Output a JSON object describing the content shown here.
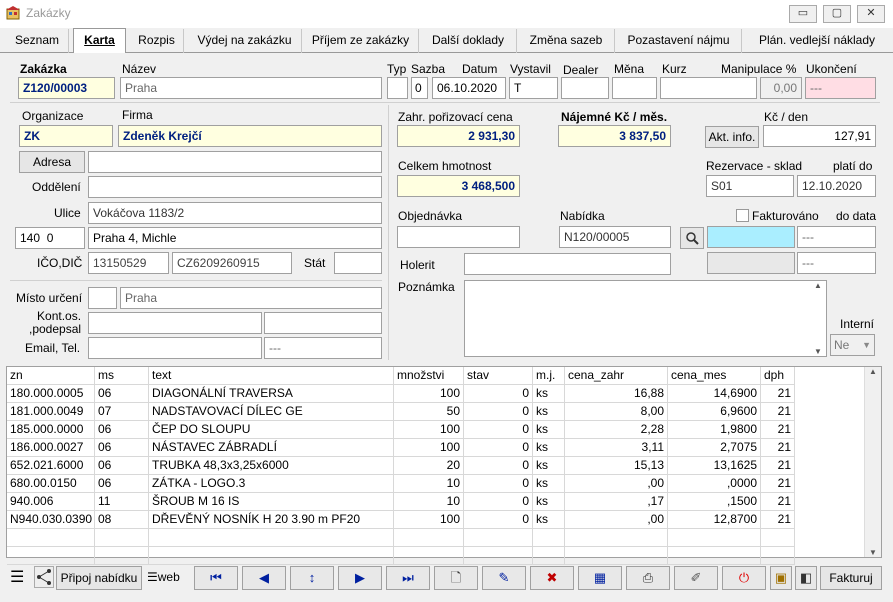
{
  "window": {
    "title": "Zakázky",
    "minimize": "▭",
    "maximize": "▢",
    "close": "✕"
  },
  "tabs": [
    "Seznam",
    "Karta",
    "Rozpis",
    "Výdej na zakázku",
    "Příjem ze zakázky",
    "Další doklady",
    "Změna sazeb",
    "Pozastavení nájmu",
    "Plán. vedlejší náklady"
  ],
  "header": {
    "zakazka_label": "Zakázka",
    "zakazka": "Z120/00003",
    "nazev_label": "Název",
    "nazev": "Praha",
    "typ_label": "Typ",
    "typ": "",
    "sazba_label": "Sazba",
    "sazba": "0",
    "datum_label": "Datum",
    "datum": "06.10.2020",
    "vystavil_label": "Vystavil",
    "vystavil": "T",
    "dealer_label": "Dealer",
    "dealer": "",
    "mena_label": "Měna",
    "mena": "",
    "kurz_label": "Kurz",
    "kurz": "",
    "manipulace_label": "Manipulace %",
    "manipulace": "0,00",
    "ukonceni_label": "Ukončení",
    "ukonceni": "---"
  },
  "left": {
    "organizace_label": "Organizace",
    "organizace": "ZK",
    "firma_label": "Firma",
    "firma": "Zdeněk Krejčí",
    "adresa_button": "Adresa",
    "adresa": "",
    "oddeleni_label": "Oddělení",
    "oddeleni": "",
    "ulice_label": "Ulice",
    "ulice": "Vokáčova 1183/2",
    "psc": "140  0",
    "mesto": "Praha 4, Michle",
    "icodic_label": "IČO,DIČ",
    "ico": "13150529",
    "dic": "CZ6209260915",
    "stat_label": "Stát",
    "stat": "",
    "misto_label": "Místo určení",
    "misto_code": "",
    "misto": "Praha",
    "kontos_label": "Kont.os.\n,podepsal",
    "kontos1": "",
    "kontos2": "",
    "email_label": "Email, Tel.",
    "email": "",
    "tel": "---"
  },
  "right": {
    "zahr_label": "Zahr. pořizovací cena",
    "zahr": "2 931,30",
    "najemne_label": "Nájemné Kč / měs.",
    "najemne": "3 837,50",
    "akt_button": "Akt. info.",
    "kcden_label": "Kč / den",
    "kcden": "127,91",
    "hmotnost_label": "Celkem hmotnost",
    "hmotnost": "3 468,500",
    "rezervace_label": "Rezervace - sklad",
    "sklad": "S01",
    "platido_label": "platí do",
    "platido": "12.10.2020",
    "objednavka_label": "Objednávka",
    "objednavka": "",
    "nabidka_label": "Nabídka",
    "nabidka": "N120/00005",
    "fakturovano_label": "Fakturováno",
    "dodata_label": "do data",
    "fak1": "",
    "fak1_date": "---",
    "fak2": "",
    "fak2_date": "---",
    "holerit_label": "Holerit",
    "holerit": "",
    "poznamka_label": "Poznámka",
    "poznamka": "",
    "interni_label": "Interní",
    "interni": "Ne"
  },
  "table": {
    "columns": [
      "zn",
      "ms",
      "text",
      "množstvi",
      "stav",
      "m.j.",
      "cena_zahr",
      "cena_mes",
      "dph"
    ],
    "rows": [
      [
        "180.000.0005",
        "06",
        "DIAGONÁLNÍ TRAVERSA",
        "100",
        "0",
        "ks",
        "16,88",
        "14,6900",
        "21"
      ],
      [
        "181.000.0049",
        "07",
        "NADSTAVOVACÍ DÍLEC GE",
        "50",
        "0",
        "ks",
        "8,00",
        "6,9600",
        "21"
      ],
      [
        "185.000.0000",
        "06",
        "ČEP DO SLOUPU",
        "100",
        "0",
        "ks",
        "2,28",
        "1,9800",
        "21"
      ],
      [
        "186.000.0027",
        "06",
        "NÁSTAVEC ZÁBRADLÍ",
        "100",
        "0",
        "ks",
        "3,11",
        "2,7075",
        "21"
      ],
      [
        "652.021.6000",
        "06",
        "TRUBKA 48,3x3,25x6000",
        "20",
        "0",
        "ks",
        "15,13",
        "13,1625",
        "21"
      ],
      [
        "680.00.0150",
        "06",
        "ZÁTKA - LOGO.3",
        "10",
        "0",
        "ks",
        ",00",
        ",0000",
        "21"
      ],
      [
        "940.006",
        "11",
        "ŠROUB M 16 IS",
        "10",
        "0",
        "ks",
        ",17",
        ",1500",
        "21"
      ],
      [
        "N940.030.0390",
        "08",
        "DŘEVĚNÝ NOSNÍK H 20 3.90 m PF20",
        "100",
        "0",
        "ks",
        ",00",
        "12,8700",
        "21"
      ],
      [
        "",
        "",
        "",
        "",
        "",
        "",
        "",
        "",
        ""
      ],
      [
        "",
        "",
        "",
        "",
        "",
        "",
        "",
        "",
        ""
      ]
    ]
  },
  "toolbar": {
    "menu": "☰",
    "tree": "⋰",
    "pripoj": "Připoj nabídku",
    "web": "☰web",
    "first": "⏮",
    "prev": "◀",
    "sort": "↕",
    "next": "▶",
    "last": "⏭",
    "new": "🗋",
    "edit": "✎",
    "delete": "✖",
    "calc": "▦",
    "print": "⎙",
    "tools": "✐",
    "power": "⏻",
    "book": "▣",
    "sound": "◧",
    "fakturuj": "Fakturuj"
  }
}
